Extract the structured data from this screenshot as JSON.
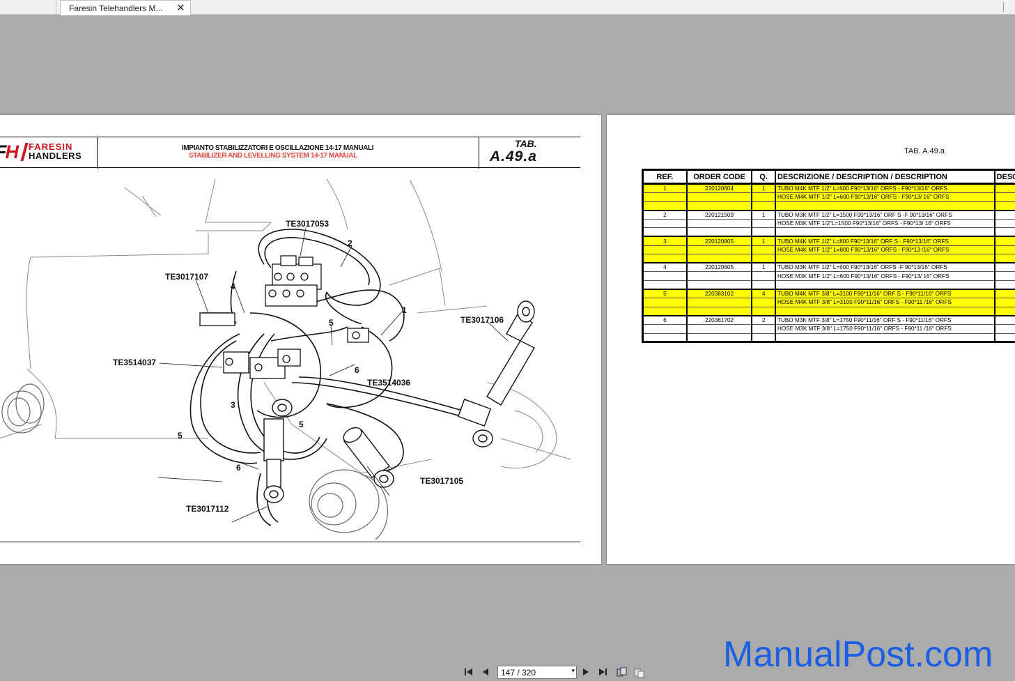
{
  "tab": {
    "title": "Faresin Telehandlers M...",
    "close": "✕"
  },
  "left_page": {
    "logo": {
      "fh_f": "F",
      "fh_h": "H",
      "brand": "FARESIN",
      "sub": "HANDLERS"
    },
    "title_it": "IMPIANTO STABILIZZATORI E OSCILLAZIONE 14-17 MANUALI",
    "title_en": "STABILIZER AND LEVELLING SYSTEM 14-17 MANUAL",
    "tab_label": "TAB.",
    "tab_code": "A.49.a",
    "callouts": {
      "te3017053": "TE3017053",
      "te3017107": "TE3017107",
      "te3017106": "TE3017106",
      "te3514037": "TE3514037",
      "te3514036": "TE3514036",
      "te3017105": "TE3017105",
      "te3017112": "TE3017112",
      "n2": "2",
      "n4": "4",
      "n1": "1",
      "n5a": "5",
      "n6a": "6",
      "n3": "3",
      "n5b": "5",
      "n5c": "5",
      "n6b": "6"
    }
  },
  "right_page": {
    "tab_label": "TAB. A.49.a",
    "headers": [
      "REF.",
      "ORDER CODE",
      "Q.",
      "DESCRIZIONE / DESCRIPTION / DESCRIPTION",
      "DESC"
    ],
    "rows": [
      {
        "ref": "1",
        "code": "220120604",
        "q": "1",
        "desc": "TUBO M4K MTF 1/2\" L=600 F90*13/16\" ORFS  - F90*13/16\" ORFS",
        "yellow": true
      },
      {
        "ref": "",
        "code": "",
        "q": "",
        "desc": "HOSE M4K MTF 1/2\" L=600 F90*13/16\" ORFS - F90*13/   16\" ORFS",
        "yellow": true
      },
      {
        "ref": "",
        "code": "",
        "q": "",
        "desc": "",
        "yellow": true,
        "thick": true
      },
      {
        "ref": "2",
        "code": "220121509",
        "q": "1",
        "desc": "TUBO M3K MTF 1/2\" L=1500 F90*13/16\" ORF S -F 90*13/16\" ORFS",
        "yellow": false
      },
      {
        "ref": "",
        "code": "",
        "q": "",
        "desc": "HOSE M3K MTF 1/2\"L=1500 F90*13/16\" ORFS - F90*13/   16\" ORFS",
        "yellow": false
      },
      {
        "ref": "",
        "code": "",
        "q": "",
        "desc": "",
        "yellow": false,
        "thick": true
      },
      {
        "ref": "3",
        "code": "220120805",
        "q": "1",
        "desc": "TUBO M4K MTF 1/2\" L=800  F90*13/16\" ORF S - F90*13/16\" ORFS",
        "yellow": true
      },
      {
        "ref": "",
        "code": "",
        "q": "",
        "desc": "HOSE M4K MTF 1/2\" L=800  F90*13/16\" ORFS - F90*13   /16\" ORFS",
        "yellow": true
      },
      {
        "ref": "",
        "code": "",
        "q": "",
        "desc": "",
        "yellow": true,
        "thick": true
      },
      {
        "ref": "4",
        "code": "220120605",
        "q": "1",
        "desc": "TUBO M3K MTF 1/2\" L=600 F90*13/16\" ORFS  -F 90*13/16\" ORFS",
        "yellow": false
      },
      {
        "ref": "",
        "code": "",
        "q": "",
        "desc": "HOSE M3K MTF 1/2\" L=600 F90*13/16\" ORFS - F90*13/   16\" ORFS",
        "yellow": false
      },
      {
        "ref": "",
        "code": "",
        "q": "",
        "desc": "",
        "yellow": false,
        "thick": true
      },
      {
        "ref": "5",
        "code": "220383102",
        "q": "4",
        "desc": "TUBO M4K MTF 3/8\" L=3100 F90*11/16\" ORF S - F90*11/16\" ORFS",
        "yellow": true
      },
      {
        "ref": "",
        "code": "",
        "q": "",
        "desc": "HOSE M4K MTF 3/8\" L=3100 F90*11/16\" ORFS - F90*11   /16\" ORFS",
        "yellow": true
      },
      {
        "ref": "",
        "code": "",
        "q": "",
        "desc": "",
        "yellow": true,
        "thick": true
      },
      {
        "ref": "6",
        "code": "220381702",
        "q": "2",
        "desc": "TUBO M3K MTF 3/8\" L=1750 F90*11/16\" ORF S - F90*11/16\" ORFS",
        "yellow": false
      },
      {
        "ref": "",
        "code": "",
        "q": "",
        "desc": "HOSE M3K MTF 3/8\" L=1750 F90*11/16\" ORFS - F90*11   /16\" ORFS",
        "yellow": false
      },
      {
        "ref": "",
        "code": "",
        "q": "",
        "desc": "",
        "yellow": false,
        "thick": true
      }
    ]
  },
  "nav": {
    "page_indicator": "147 / 320",
    "dropdown_arrow": "▾"
  },
  "watermark": "ManualPost.com",
  "colors": {
    "highlight": "#ffff00",
    "brand_red": "#d0141e",
    "watermark_blue": "#1a5fe6",
    "viewer_bg": "#ababab"
  }
}
